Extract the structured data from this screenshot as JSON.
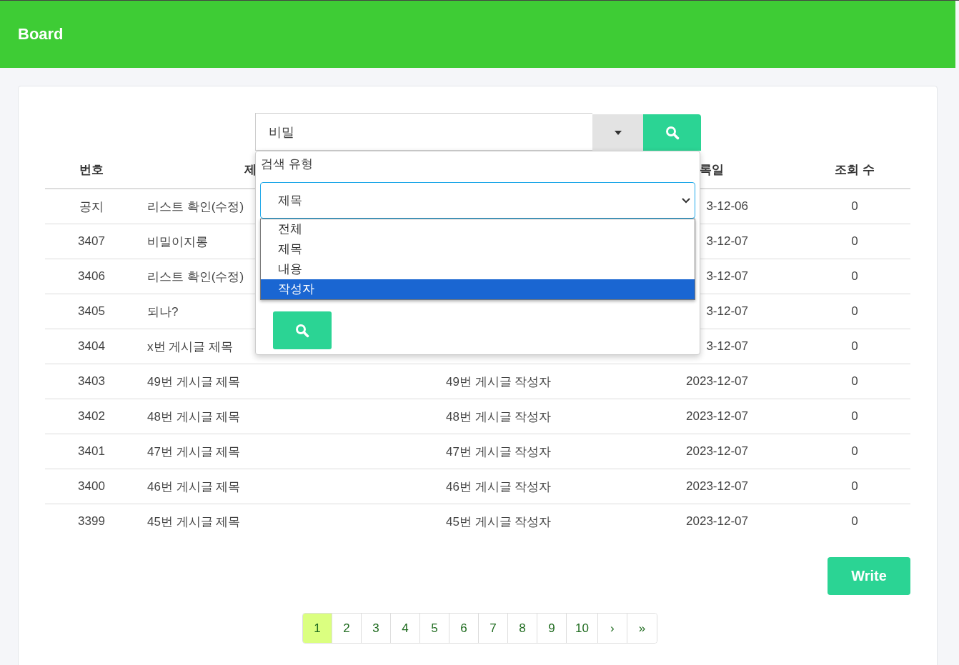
{
  "header": {
    "title": "Board"
  },
  "search": {
    "value": "비밀"
  },
  "search_panel": {
    "label": "검색 유형",
    "select_value": "제목",
    "options": [
      {
        "label": "전체",
        "selected": false
      },
      {
        "label": "제목",
        "selected": false
      },
      {
        "label": "내용",
        "selected": false
      },
      {
        "label": "작성자",
        "selected": true
      }
    ]
  },
  "table": {
    "columns": {
      "number": "번호",
      "title": "제",
      "date": "록일",
      "views": "조회 수"
    },
    "rows": [
      {
        "number": "공지",
        "title": "리스트 확인(수정)",
        "date": "3-12-06",
        "views": "0"
      },
      {
        "number": "3407",
        "title": "비밀이지롱",
        "date": "3-12-07",
        "views": "0"
      },
      {
        "number": "3406",
        "title": "리스트 확인(수정)",
        "date": "3-12-07",
        "views": "0"
      },
      {
        "number": "3405",
        "title": "되나?",
        "date": "3-12-07",
        "views": "0"
      },
      {
        "number": "3404",
        "title": "x번 게시글 제목",
        "date": "3-12-07",
        "views": "0"
      },
      {
        "number": "3403",
        "title": "49번 게시글 제목",
        "writer": "49번 게시글 작성자",
        "date": "2023-12-07",
        "views": "0"
      },
      {
        "number": "3402",
        "title": "48번 게시글 제목",
        "writer": "48번 게시글 작성자",
        "date": "2023-12-07",
        "views": "0"
      },
      {
        "number": "3401",
        "title": "47번 게시글 제목",
        "writer": "47번 게시글 작성자",
        "date": "2023-12-07",
        "views": "0"
      },
      {
        "number": "3400",
        "title": "46번 게시글 제목",
        "writer": "46번 게시글 작성자",
        "date": "2023-12-07",
        "views": "0"
      },
      {
        "number": "3399",
        "title": "45번 게시글 제목",
        "writer": "45번 게시글 작성자",
        "date": "2023-12-07",
        "views": "0"
      }
    ]
  },
  "write_button": "Write",
  "pagination": [
    {
      "label": "1",
      "selected": true
    },
    {
      "label": "2",
      "selected": false
    },
    {
      "label": "3",
      "selected": false
    },
    {
      "label": "4",
      "selected": false
    },
    {
      "label": "5",
      "selected": false
    },
    {
      "label": "6",
      "selected": false
    },
    {
      "label": "7",
      "selected": false
    },
    {
      "label": "8",
      "selected": false
    },
    {
      "label": "9",
      "selected": false
    },
    {
      "label": "10",
      "selected": false
    },
    {
      "label": "›",
      "selected": false
    },
    {
      "label": "»",
      "selected": false
    }
  ]
}
